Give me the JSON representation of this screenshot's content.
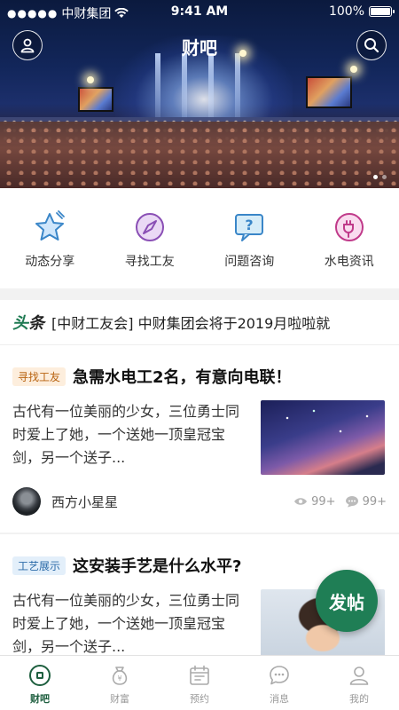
{
  "status_bar": {
    "carrier": "中财集团",
    "signal_dots": "●●●●●",
    "time": "9:41 AM",
    "battery": "100%"
  },
  "header": {
    "title": "财吧",
    "left_icon": "user-icon",
    "right_icon": "search-icon",
    "banner_slides": 2,
    "banner_active": 1
  },
  "quick_nav": [
    {
      "label": "动态分享",
      "icon": "star-icon"
    },
    {
      "label": "寻找工友",
      "icon": "compass-icon"
    },
    {
      "label": "问题咨询",
      "icon": "question-chat-icon"
    },
    {
      "label": "水电资讯",
      "icon": "plug-icon"
    }
  ],
  "headline": {
    "tag_part1": "头",
    "tag_part2": "条",
    "text": "[中财工友会] 中财集团会将于2019月啦啦就"
  },
  "posts": [
    {
      "badge": "寻找工友",
      "badge_color": "orange",
      "title": "急需水电工2名，有意向电联！",
      "excerpt": "古代有一位美丽的少女，三位勇士同时爱上了她，一个送她一顶皇冠宝剑，另一个送子...",
      "author": "西方小星星",
      "views": "99+",
      "comments": "99+"
    },
    {
      "badge": "工艺展示",
      "badge_color": "blue",
      "title": "这安装手艺是什么水平?",
      "excerpt": "古代有一位美丽的少女，三位勇士同时爱上了她，一个送她一顶皇冠宝剑，另一个送子..."
    }
  ],
  "fab": {
    "label": "发帖"
  },
  "tabs": [
    {
      "label": "财吧",
      "icon": "home-icon",
      "active": true
    },
    {
      "label": "财富",
      "icon": "money-bag-icon",
      "active": false
    },
    {
      "label": "预约",
      "icon": "calendar-icon",
      "active": false
    },
    {
      "label": "消息",
      "icon": "message-icon",
      "active": false
    },
    {
      "label": "我的",
      "icon": "profile-icon",
      "active": false
    }
  ],
  "colors": {
    "brand_green": "#1f7e55",
    "badge_orange_bg": "#fdeedd",
    "badge_blue_bg": "#e3effa"
  }
}
